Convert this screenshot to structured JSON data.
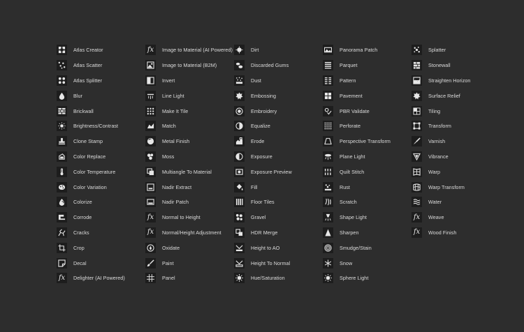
{
  "columns": [
    [
      {
        "label": "Atlas Creator",
        "icon": "atlas-creator-icon"
      },
      {
        "label": "Atlas Scatter",
        "icon": "atlas-scatter-icon"
      },
      {
        "label": "Atlas Splitter",
        "icon": "atlas-splitter-icon"
      },
      {
        "label": "Blur",
        "icon": "blur-icon"
      },
      {
        "label": "Brickwall",
        "icon": "brickwall-icon"
      },
      {
        "label": "Brightness/Contrast",
        "icon": "brightness-contrast-icon"
      },
      {
        "label": "Clone Stamp",
        "icon": "clone-stamp-icon"
      },
      {
        "label": "Color Replace",
        "icon": "color-replace-icon"
      },
      {
        "label": "Color Temperature",
        "icon": "color-temperature-icon"
      },
      {
        "label": "Color Variation",
        "icon": "color-variation-icon"
      },
      {
        "label": "Colorize",
        "icon": "colorize-icon"
      },
      {
        "label": "Corrode",
        "icon": "corrode-icon"
      },
      {
        "label": "Cracks",
        "icon": "cracks-icon"
      },
      {
        "label": "Crop",
        "icon": "crop-icon"
      },
      {
        "label": "Decal",
        "icon": "decal-icon"
      },
      {
        "label": "Delighter (AI Powered)",
        "icon": "fx-icon"
      }
    ],
    [
      {
        "label": "Image to Material (AI Powered)",
        "icon": "fx-icon"
      },
      {
        "label": "Image to Material (B2M)",
        "icon": "image-to-material-icon"
      },
      {
        "label": "Invert",
        "icon": "invert-icon"
      },
      {
        "label": "Line Light",
        "icon": "line-light-icon"
      },
      {
        "label": "Make It Tile",
        "icon": "make-it-tile-icon"
      },
      {
        "label": "Match",
        "icon": "match-icon"
      },
      {
        "label": "Metal Finish",
        "icon": "metal-finish-icon"
      },
      {
        "label": "Moss",
        "icon": "moss-icon"
      },
      {
        "label": "Multiangle To Material",
        "icon": "multiangle-icon"
      },
      {
        "label": "Nadir Extract",
        "icon": "nadir-extract-icon"
      },
      {
        "label": "Nadir Patch",
        "icon": "nadir-patch-icon"
      },
      {
        "label": "Normal to Height",
        "icon": "fx-icon"
      },
      {
        "label": "Normal/Height Adjustment",
        "icon": "fx-icon"
      },
      {
        "label": "Oxidate",
        "icon": "oxidate-icon"
      },
      {
        "label": "Paint",
        "icon": "paint-brush-icon"
      },
      {
        "label": "Panel",
        "icon": "panel-icon"
      }
    ],
    [
      {
        "label": "Dirt",
        "icon": "dirt-icon"
      },
      {
        "label": "Discarded Gums",
        "icon": "discarded-gums-icon"
      },
      {
        "label": "Dust",
        "icon": "dust-icon"
      },
      {
        "label": "Embossing",
        "icon": "embossing-icon"
      },
      {
        "label": "Embroidery",
        "icon": "embroidery-icon"
      },
      {
        "label": "Equalize",
        "icon": "equalize-icon"
      },
      {
        "label": "Erode",
        "icon": "erode-icon"
      },
      {
        "label": "Exposure",
        "icon": "exposure-icon"
      },
      {
        "label": "Exposure Preview",
        "icon": "exposure-preview-icon"
      },
      {
        "label": "Fill",
        "icon": "fill-icon"
      },
      {
        "label": "Floor Tiles",
        "icon": "floor-tiles-icon"
      },
      {
        "label": "Gravel",
        "icon": "gravel-icon"
      },
      {
        "label": "HDR Merge",
        "icon": "hdr-merge-icon"
      },
      {
        "label": "Height to AO",
        "icon": "height-to-ao-icon"
      },
      {
        "label": "Height To Normal",
        "icon": "height-to-normal-icon"
      },
      {
        "label": "Hue/Saturation",
        "icon": "hue-saturation-icon"
      }
    ],
    [
      {
        "label": "Panorama Patch",
        "icon": "panorama-patch-icon"
      },
      {
        "label": "Parquet",
        "icon": "parquet-icon"
      },
      {
        "label": "Pattern",
        "icon": "pattern-icon"
      },
      {
        "label": "Pavement",
        "icon": "pavement-icon"
      },
      {
        "label": "PBR Validate",
        "icon": "pbr-validate-icon"
      },
      {
        "label": "Perforate",
        "icon": "perforate-icon"
      },
      {
        "label": "Perspective Transform",
        "icon": "perspective-transform-icon"
      },
      {
        "label": "Plane Light",
        "icon": "plane-light-icon"
      },
      {
        "label": "Quilt Stitch",
        "icon": "quilt-stitch-icon"
      },
      {
        "label": "Rust",
        "icon": "rust-icon"
      },
      {
        "label": "Scratch",
        "icon": "scratch-icon"
      },
      {
        "label": "Shape Light",
        "icon": "shape-light-icon"
      },
      {
        "label": "Sharpen",
        "icon": "sharpen-icon"
      },
      {
        "label": "Smudge/Stain",
        "icon": "smudge-stain-icon"
      },
      {
        "label": "Snow",
        "icon": "snowflake-icon"
      },
      {
        "label": "Sphere Light",
        "icon": "sphere-light-icon"
      }
    ],
    [
      {
        "label": "Splatter",
        "icon": "splatter-icon"
      },
      {
        "label": "Stonewall",
        "icon": "stonewall-icon"
      },
      {
        "label": "Straighten Horizon",
        "icon": "straighten-horizon-icon"
      },
      {
        "label": "Surface Relief",
        "icon": "surface-relief-icon"
      },
      {
        "label": "Tiling",
        "icon": "tiling-icon"
      },
      {
        "label": "Transform",
        "icon": "transform-icon"
      },
      {
        "label": "Varnish",
        "icon": "varnish-icon"
      },
      {
        "label": "Vibrance",
        "icon": "vibrance-icon"
      },
      {
        "label": "Warp",
        "icon": "warp-icon"
      },
      {
        "label": "Warp Transform",
        "icon": "warp-transform-icon"
      },
      {
        "label": "Water",
        "icon": "water-icon"
      },
      {
        "label": "Weave",
        "icon": "fx-icon"
      },
      {
        "label": "Wood Finish",
        "icon": "fx-icon"
      }
    ]
  ],
  "colors": {
    "background": "#2d2d2d",
    "icon_tile": "#1d1d1d",
    "text": "#dcdcdc",
    "icon_glyph": "#e6e6e6"
  }
}
